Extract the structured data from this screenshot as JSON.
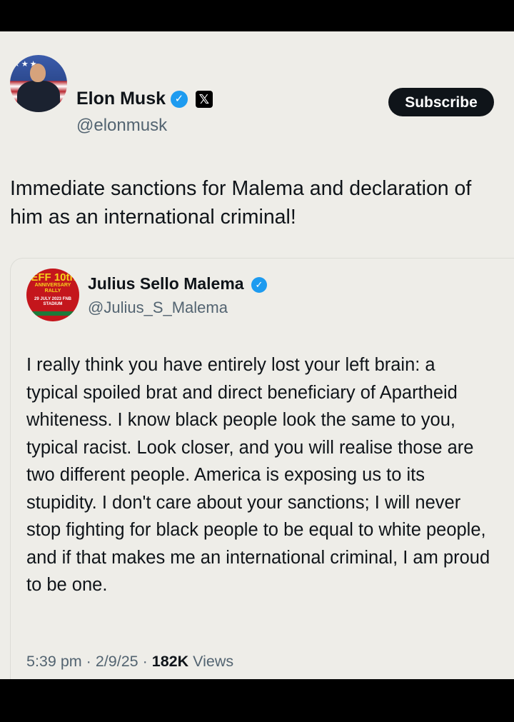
{
  "post": {
    "author_name": "Elon Musk",
    "author_handle": "@elonmusk",
    "subscribe_label": "Subscribe",
    "text": "Immediate sanctions for Malema and declaration of him as an international criminal!"
  },
  "quoted_post": {
    "author_name": "Julius Sello Malema",
    "author_handle": "@Julius_S_Malema",
    "avatar_text": {
      "line1": "EFF 10th",
      "line2": "ANNIVERSARY RALLY",
      "line3": "29 JULY 2023 FNB STADIUM"
    },
    "text": "I really think you have entirely lost your left brain: a typical spoiled brat and direct beneficiary of Apartheid whiteness. I know black people look the same to you, typical racist. Look closer, and you will realise those are two different people. America is exposing us to its stupidity. I don't care about your sanctions; I will never stop fighting for black people to be equal to white people, and if that makes me an international criminal, I am proud to be one.",
    "time": "5:39 pm",
    "date": "2/9/25",
    "separator": "·",
    "views_count": "182K",
    "views_label": "Views"
  },
  "icons": {
    "verified": "verified-badge-icon",
    "x_logo": "x-logo-icon"
  },
  "colors": {
    "background": "#eeede8",
    "verified_blue": "#1d9bf0",
    "secondary_text": "#536471",
    "button_bg": "#0f1419"
  }
}
